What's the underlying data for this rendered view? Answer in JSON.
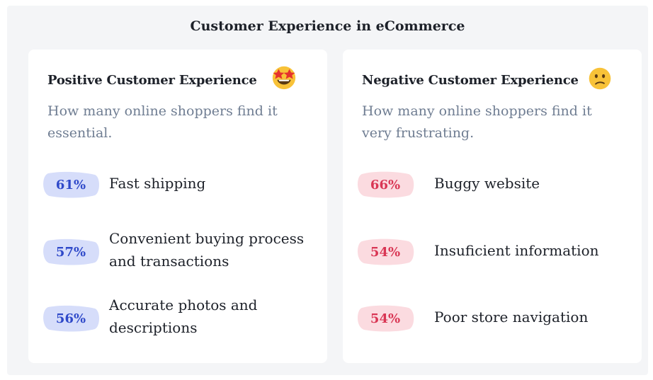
{
  "title": "Customer Experience in eCommerce",
  "colors": {
    "positive_badge_bg": "#d6ddfa",
    "positive_badge_text": "#2f49c9",
    "negative_badge_bg": "#fbdbe0",
    "negative_badge_text": "#d93654",
    "emoji_yellow": "#f8c238"
  },
  "positive": {
    "heading": "Positive Customer Experience",
    "emoji": "star-struck-emoji",
    "subtitle": "How many online shoppers find it essential.",
    "items": [
      {
        "percent": "61%",
        "label": "Fast shipping"
      },
      {
        "percent": "57%",
        "label": "Convenient buying process and transactions"
      },
      {
        "percent": "56%",
        "label": "Accurate photos and descriptions"
      }
    ]
  },
  "negative": {
    "heading": "Negative Customer Experience",
    "emoji": "confused-face-emoji",
    "subtitle": "How many online shoppers find it very frustrating.",
    "items": [
      {
        "percent": "66%",
        "label": "Buggy website"
      },
      {
        "percent": "54%",
        "label": "Insuficient information"
      },
      {
        "percent": "54%",
        "label": "Poor store navigation"
      }
    ]
  },
  "chart_data": {
    "type": "table",
    "title": "Customer Experience in eCommerce",
    "groups": [
      {
        "name": "Positive Customer Experience",
        "subtitle": "How many online shoppers find it essential.",
        "categories": [
          "Fast shipping",
          "Convenient buying process and transactions",
          "Accurate photos and descriptions"
        ],
        "values": [
          61,
          57,
          56
        ]
      },
      {
        "name": "Negative Customer Experience",
        "subtitle": "How many online shoppers find it very frustrating.",
        "categories": [
          "Buggy website",
          "Insuficient information",
          "Poor store navigation"
        ],
        "values": [
          66,
          54,
          54
        ]
      }
    ]
  }
}
